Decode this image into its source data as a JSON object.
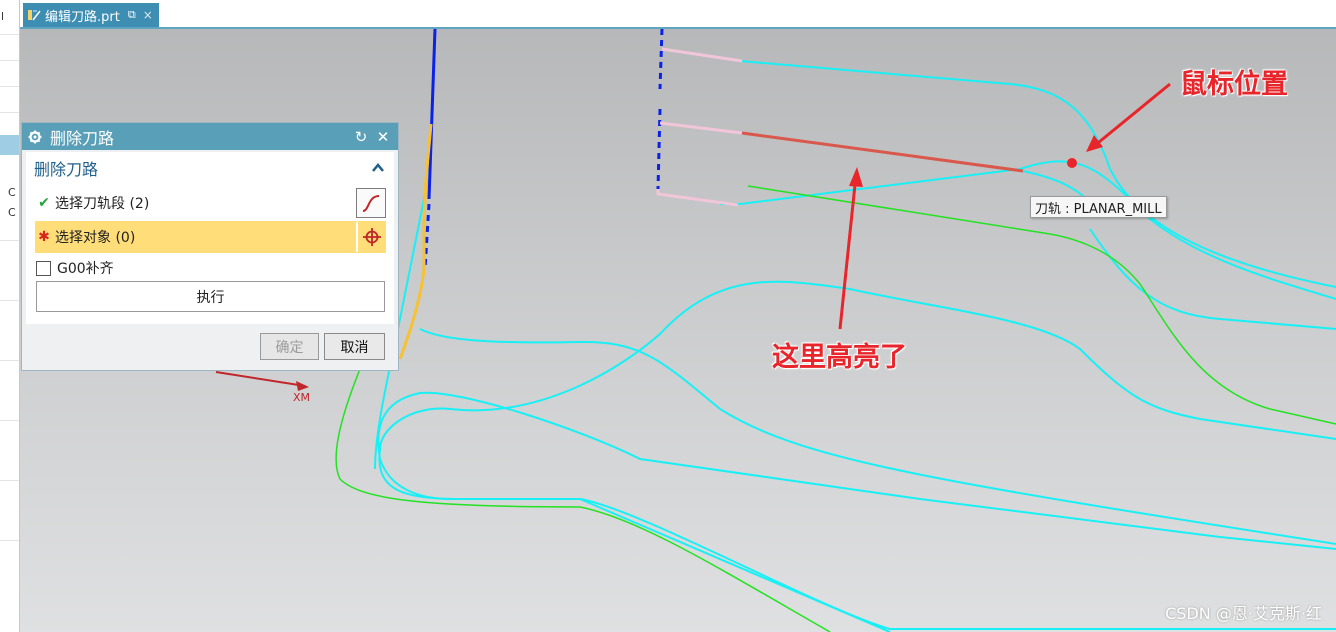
{
  "left_strip": {
    "texts": [
      "l",
      "C",
      "C"
    ]
  },
  "tab": {
    "label": "编辑刀路.prt",
    "icon": "part-file-icon",
    "pin": "⧉",
    "close": "×"
  },
  "viewport": {
    "tooltip": "刀轨 : PLANAR_MILL",
    "annotation_highlight": "这里高亮了",
    "annotation_mouse": "鼠标位置",
    "axis_label": "XM",
    "watermark": "CSDN @恩·艾克斯·红",
    "colors": {
      "path_cyan": "#19f0f5",
      "path_green": "#22e222",
      "highlight_red": "#d9574b",
      "annotation_red": "#e8252b",
      "rapid_blue": "#0b21e8",
      "feed_yellow": "#f6c232",
      "pink": "#f0c6d8"
    }
  },
  "dialog": {
    "title": "删除刀路",
    "reset_icon": "↻",
    "close_icon": "✕",
    "group_label": "删除刀路",
    "row_toolpath_label": "选择刀轨段 (2)",
    "row_object_label": "选择对象 (0)",
    "check_mark": "✔",
    "required_mark": "✱",
    "g00_label": "G00补齐",
    "execute_label": "执行",
    "ok_label": "确定",
    "cancel_label": "取消"
  }
}
